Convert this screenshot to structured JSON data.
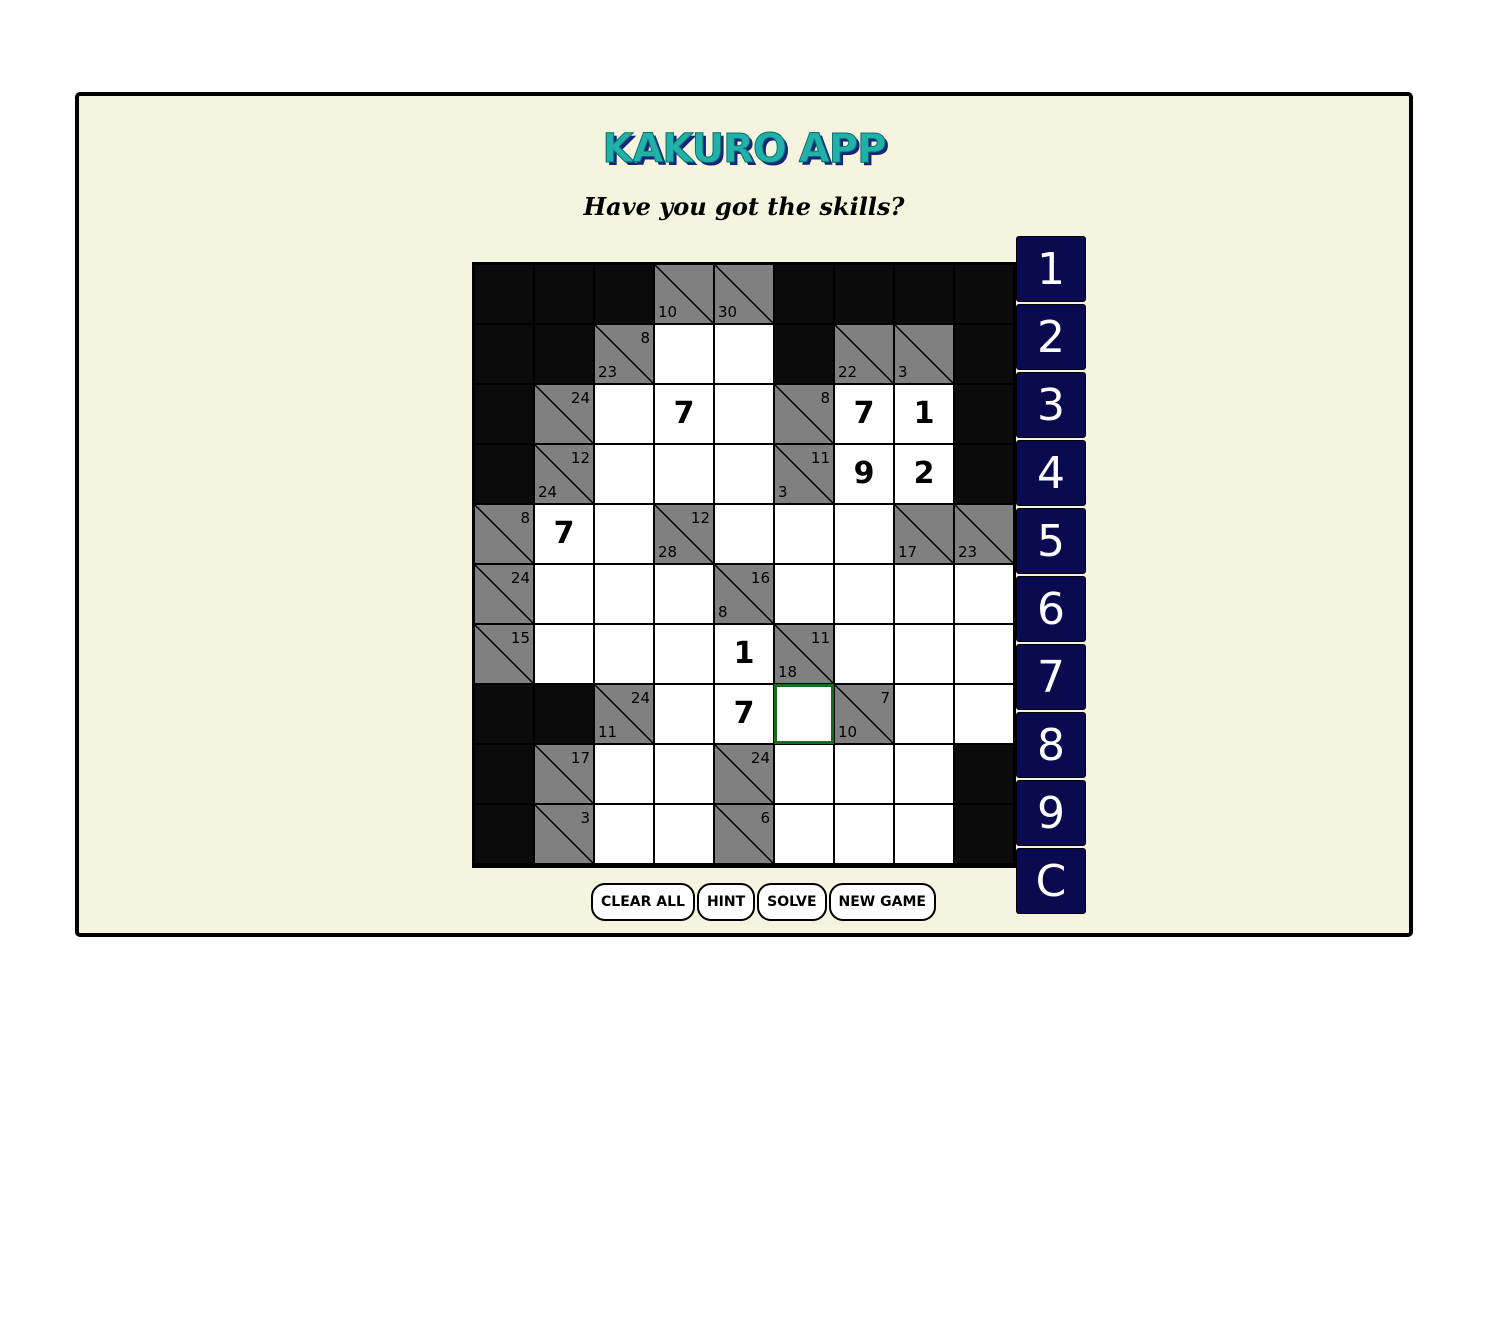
{
  "header": {
    "title": "KAKURO APP",
    "subtitle": "Have you got the skills?"
  },
  "board": {
    "rows": 10,
    "cols": 9,
    "selected": [
      7,
      5
    ],
    "cells": [
      [
        {
          "t": "b"
        },
        {
          "t": "b"
        },
        {
          "t": "b"
        },
        {
          "t": "c",
          "d": "10"
        },
        {
          "t": "c",
          "d": "30"
        },
        {
          "t": "b"
        },
        {
          "t": "b"
        },
        {
          "t": "b"
        },
        {
          "t": "b"
        }
      ],
      [
        {
          "t": "b"
        },
        {
          "t": "b"
        },
        {
          "t": "c",
          "a": "8",
          "d": "23"
        },
        {
          "t": "w"
        },
        {
          "t": "w"
        },
        {
          "t": "b"
        },
        {
          "t": "c",
          "d": "22"
        },
        {
          "t": "c",
          "d": "3"
        },
        {
          "t": "b"
        }
      ],
      [
        {
          "t": "b"
        },
        {
          "t": "c",
          "a": "24"
        },
        {
          "t": "w"
        },
        {
          "t": "w",
          "v": "7"
        },
        {
          "t": "w"
        },
        {
          "t": "c",
          "a": "8"
        },
        {
          "t": "w",
          "v": "7"
        },
        {
          "t": "w",
          "v": "1"
        },
        {
          "t": "b"
        }
      ],
      [
        {
          "t": "b"
        },
        {
          "t": "c",
          "a": "12",
          "d": "24"
        },
        {
          "t": "w"
        },
        {
          "t": "w"
        },
        {
          "t": "w"
        },
        {
          "t": "c",
          "a": "11",
          "d": "3"
        },
        {
          "t": "w",
          "v": "9"
        },
        {
          "t": "w",
          "v": "2"
        },
        {
          "t": "b"
        }
      ],
      [
        {
          "t": "c",
          "a": "8"
        },
        {
          "t": "w",
          "v": "7"
        },
        {
          "t": "w"
        },
        {
          "t": "c",
          "a": "12",
          "d": "28"
        },
        {
          "t": "w"
        },
        {
          "t": "w"
        },
        {
          "t": "w"
        },
        {
          "t": "c",
          "d": "17"
        },
        {
          "t": "c",
          "d": "23"
        }
      ],
      [
        {
          "t": "c",
          "a": "24"
        },
        {
          "t": "w"
        },
        {
          "t": "w"
        },
        {
          "t": "w"
        },
        {
          "t": "c",
          "a": "16",
          "d": "8"
        },
        {
          "t": "w"
        },
        {
          "t": "w"
        },
        {
          "t": "w"
        },
        {
          "t": "w"
        }
      ],
      [
        {
          "t": "c",
          "a": "15"
        },
        {
          "t": "w"
        },
        {
          "t": "w"
        },
        {
          "t": "w"
        },
        {
          "t": "w",
          "v": "1"
        },
        {
          "t": "c",
          "a": "11",
          "d": "18"
        },
        {
          "t": "w"
        },
        {
          "t": "w"
        },
        {
          "t": "w"
        }
      ],
      [
        {
          "t": "b"
        },
        {
          "t": "b"
        },
        {
          "t": "c",
          "a": "24",
          "d": "11"
        },
        {
          "t": "w"
        },
        {
          "t": "w",
          "v": "7"
        },
        {
          "t": "w"
        },
        {
          "t": "c",
          "a": "7",
          "d": "10"
        },
        {
          "t": "w"
        },
        {
          "t": "w"
        }
      ],
      [
        {
          "t": "b"
        },
        {
          "t": "c",
          "a": "17"
        },
        {
          "t": "w"
        },
        {
          "t": "w"
        },
        {
          "t": "c",
          "a": "24"
        },
        {
          "t": "w"
        },
        {
          "t": "w"
        },
        {
          "t": "w"
        },
        {
          "t": "b"
        }
      ],
      [
        {
          "t": "b"
        },
        {
          "t": "c",
          "a": "3"
        },
        {
          "t": "w"
        },
        {
          "t": "w"
        },
        {
          "t": "c",
          "a": "6"
        },
        {
          "t": "w"
        },
        {
          "t": "w"
        },
        {
          "t": "w"
        },
        {
          "t": "b"
        }
      ]
    ]
  },
  "numpad": {
    "keys": [
      "1",
      "2",
      "3",
      "4",
      "5",
      "6",
      "7",
      "8",
      "9",
      "C"
    ]
  },
  "controls": {
    "clear_all": "CLEAR ALL",
    "hint": "HINT",
    "solve": "SOLVE",
    "new_game": "NEW GAME"
  },
  "colors": {
    "panel_bg": "#f5f5df",
    "clue_cell": "#808080",
    "block_cell": "#0b0b0b",
    "numpad_key": "#0a0a50",
    "title": "#20b2aa",
    "selected_border": "#1b6b1b"
  }
}
